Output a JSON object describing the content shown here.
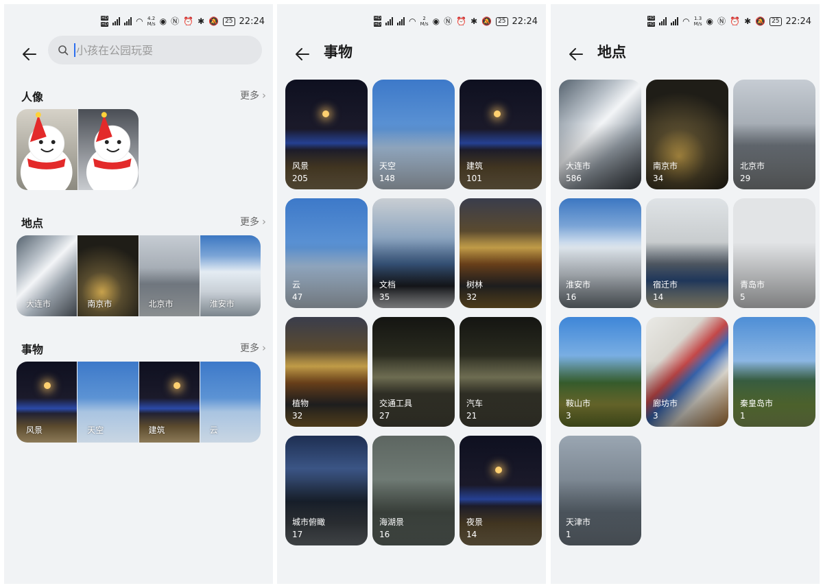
{
  "status_bars": [
    {
      "speed_value": "4.2",
      "speed_unit": "M/s",
      "battery": "25",
      "time": "22:24"
    },
    {
      "speed_value": "2",
      "speed_unit": "M/s",
      "battery": "25",
      "time": "22:24"
    },
    {
      "speed_value": "1.3",
      "speed_unit": "M/s",
      "battery": "25",
      "time": "22:24"
    }
  ],
  "search_screen": {
    "placeholder": "小孩在公园玩耍",
    "portrait": {
      "title": "人像",
      "more": "更多"
    },
    "places": {
      "title": "地点",
      "more": "更多",
      "items": [
        "大连市",
        "南京市",
        "北京市",
        "淮安市"
      ]
    },
    "things": {
      "title": "事物",
      "more": "更多",
      "items": [
        "风景",
        "天空",
        "建筑",
        "云"
      ]
    }
  },
  "things_screen": {
    "title": "事物",
    "items": [
      {
        "name": "风景",
        "count": "205"
      },
      {
        "name": "天空",
        "count": "148"
      },
      {
        "name": "建筑",
        "count": "101"
      },
      {
        "name": "云",
        "count": "47"
      },
      {
        "name": "文档",
        "count": "35"
      },
      {
        "name": "树林",
        "count": "32"
      },
      {
        "name": "植物",
        "count": "32"
      },
      {
        "name": "交通工具",
        "count": "27"
      },
      {
        "name": "汽车",
        "count": "21"
      },
      {
        "name": "城市俯瞰",
        "count": "17"
      },
      {
        "name": "海湖景",
        "count": "16"
      },
      {
        "name": "夜景",
        "count": "14"
      }
    ]
  },
  "places_screen": {
    "title": "地点",
    "items": [
      {
        "name": "大连市",
        "count": "586"
      },
      {
        "name": "南京市",
        "count": "34"
      },
      {
        "name": "北京市",
        "count": "29"
      },
      {
        "name": "淮安市",
        "count": "16"
      },
      {
        "name": "宿迁市",
        "count": "14"
      },
      {
        "name": "青岛市",
        "count": "5"
      },
      {
        "name": "鞍山市",
        "count": "3"
      },
      {
        "name": "廊坊市",
        "count": "3"
      },
      {
        "name": "秦皇岛市",
        "count": "1"
      },
      {
        "name": "天津市",
        "count": "1"
      }
    ]
  }
}
